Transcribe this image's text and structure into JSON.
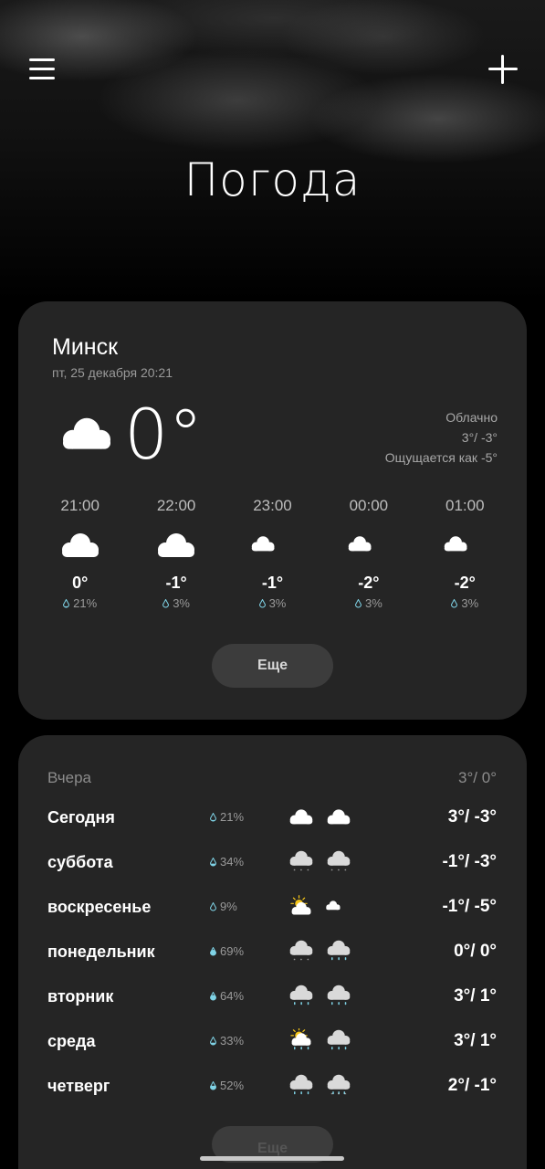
{
  "header": {
    "title": "Погода",
    "menu_icon": "hamburger-menu-icon",
    "add_icon": "plus-icon"
  },
  "current": {
    "city": "Минск",
    "datetime": "пт, 25 декабря 20:21",
    "temperature": "0°",
    "icon": "cloudy-icon",
    "condition": "Облачно",
    "high_low": "3°/ -3°",
    "feels_like": "Ощущается как -5°"
  },
  "hourly": [
    {
      "time": "21:00",
      "icon": "cloudy-icon",
      "temp": "0°",
      "precip": "21%"
    },
    {
      "time": "22:00",
      "icon": "cloudy-icon",
      "temp": "-1°",
      "precip": "3%"
    },
    {
      "time": "23:00",
      "icon": "moon-cloud-icon",
      "temp": "-1°",
      "precip": "3%"
    },
    {
      "time": "00:00",
      "icon": "moon-cloud-icon",
      "temp": "-2°",
      "precip": "3%"
    },
    {
      "time": "01:00",
      "icon": "moon-cloud-icon",
      "temp": "-2°",
      "precip": "3%"
    }
  ],
  "more_label": "Еще",
  "daily": {
    "yesterday": {
      "label": "Вчера",
      "temps": "3°/ 0°"
    },
    "days": [
      {
        "name": "Сегодня",
        "precip": "21%",
        "icon_day": "cloudy-icon",
        "icon_night": "cloudy-icon",
        "temps": "3°/ -3°"
      },
      {
        "name": "суббота",
        "precip": "34%",
        "icon_day": "snow-cloud-icon",
        "icon_night": "snow-cloud-icon",
        "temps": "-1°/ -3°"
      },
      {
        "name": "воскресенье",
        "precip": "9%",
        "icon_day": "sun-cloud-icon",
        "icon_night": "moon-cloud-icon",
        "temps": "-1°/ -5°"
      },
      {
        "name": "понедельник",
        "precip": "69%",
        "icon_day": "snow-cloud-icon",
        "icon_night": "rain-cloud-icon",
        "temps": "0°/ 0°"
      },
      {
        "name": "вторник",
        "precip": "64%",
        "icon_day": "rain-cloud-icon",
        "icon_night": "rain-cloud-icon",
        "temps": "3°/ 1°"
      },
      {
        "name": "среда",
        "precip": "33%",
        "icon_day": "sun-rain-cloud-icon",
        "icon_night": "rain-cloud-icon",
        "temps": "3°/ 1°"
      },
      {
        "name": "четверг",
        "precip": "52%",
        "icon_day": "rain-cloud-icon",
        "icon_night": "sleet-cloud-icon",
        "temps": "2°/ -1°"
      }
    ]
  },
  "colors": {
    "background": "#000000",
    "card": "#252525",
    "button": "#3c3c3c",
    "moon": "#f5c518",
    "drop": "#7fd3e6",
    "secondary_text": "#9a9a9a"
  }
}
